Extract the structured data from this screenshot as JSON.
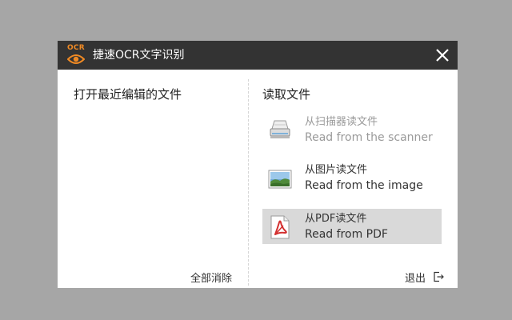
{
  "window": {
    "title": "捷速OCR文字识别",
    "logo_text": "OCR",
    "close_icon": "close-icon",
    "accent_color": "#f08a24",
    "titlebar_color": "#333333"
  },
  "recent": {
    "heading": "打开最近编辑的文件",
    "clear_all_label": "全部消除"
  },
  "read": {
    "heading": "读取文件",
    "options": [
      {
        "label_cn": "从扫描器读文件",
        "label_en": "Read from the scanner",
        "icon": "scanner-icon",
        "state": "disabled"
      },
      {
        "label_cn": "从图片读文件",
        "label_en": "Read from the image",
        "icon": "image-icon",
        "state": "normal"
      },
      {
        "label_cn": "从PDF读文件",
        "label_en": "Read from PDF",
        "icon": "pdf-icon",
        "state": "selected"
      }
    ]
  },
  "footer": {
    "exit_label": "退出",
    "exit_icon": "exit-icon"
  }
}
